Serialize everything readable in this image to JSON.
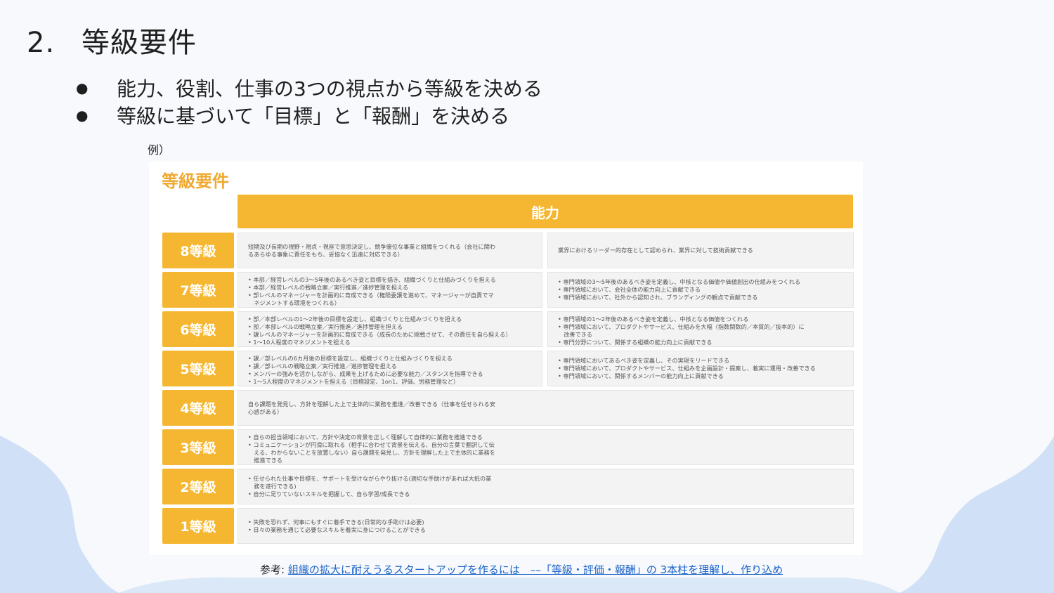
{
  "slide": {
    "number": "2.",
    "title": "等級要件",
    "bullets": [
      "能力、役割、仕事の3つの視点から等級を決める",
      "等級に基づいて「目標」と「報酬」を決める"
    ],
    "bullet_marker": "●",
    "example_label": "例）"
  },
  "table": {
    "title": "等級要件",
    "category_header": "能力",
    "rows": [
      {
        "grade": "8等級",
        "left": [
          "短期及び長期の視野・視点・視座で意思決定し、競争優位な事業と組織をつくれる（会社に関わ",
          "るあらゆる事象に責任をもち、妥協なく迅速に対応できる）"
        ],
        "right": [
          "業界におけるリーダー的存在として認められ、業界に対して技術貢献できる"
        ]
      },
      {
        "grade": "7等級",
        "left": [
          "• 本部／経営レベルの3〜5年後のあるべき姿と目標を描き、組織づくりと仕組みづくりを担える",
          "• 本部／経営レベルの戦略立案／実行推進／進捗管理を担える",
          "• 部レベルのマネージャーを計画的に育成できる（権限委譲を進めて、マネージャーが自責でマ",
          "　ネジメントする環境をつくれる）"
        ],
        "right": [
          "• 専門領域の3〜5年後のあるべき姿を定義し、中核となる価値や価値創出の仕組みをつくれる",
          "• 専門領域において、会社全体の能力向上に貢献できる",
          "• 専門領域において、社外から認知され、ブランディングの観点で貢献できる"
        ]
      },
      {
        "grade": "6等級",
        "left": [
          "• 部／本部レベルの1〜2年後の目標を設定し、組織づくりと仕組みづくりを担える",
          "• 部／本部レベルの戦略立案／実行推進／進捗管理を担える",
          "• 課レベルのマネージャーを計画的に育成できる（成長のために挑戦させて、その責任を自ら担える）",
          "• 1〜10人程度のマネジメントを担える"
        ],
        "right": [
          "• 専門領域の1〜2年後のあるべき姿を定義し、中核となる価値をつくれる",
          "• 専門領域において、プロダクトやサービス、仕組みを大幅（指数関数的／本質的／抜本的）に",
          "　改善できる",
          "• 専門分野について、関係する組織の能力向上に貢献できる"
        ]
      },
      {
        "grade": "5等級",
        "left": [
          "• 課／部レベルの6カ月後の目標を設定し、組織づくりと仕組みづくりを担える",
          "• 課／部レベルの戦略立案／実行推進／進捗管理を担える",
          "• メンバーの強みを活かしながら、成果を上げるために必要な能力／スタンスを指導できる",
          "• 1〜5人程度のマネジメントを担える（目標設定、1on1、評価、労務管理など）"
        ],
        "right": [
          "• 専門領域においてあるべき姿を定義し、その実現をリードできる",
          "• 専門領域において、プロダクトやサービス、仕組みを企画設計・提案し、着実に運用・改善できる",
          "• 専門領域において、関係するメンバーの能力向上に貢献できる"
        ]
      },
      {
        "grade": "4等級",
        "full": [
          "自ら課題を発見し、方針を理解した上で主体的に業務を推進／改善できる（仕事を任せられる安",
          "心感がある）"
        ]
      },
      {
        "grade": "3等級",
        "full": [
          "• 自らの担当領域において、方針や決定の背景を正しく理解して自律的に業務を推進できる",
          "• コミュニケーションが円滑に取れる（相手に合わせて背景を伝える、自分の言葉で翻訳して伝",
          "　える、わからないことを放置しない）自ら課題を発見し、方針を理解した上で主体的に業務を",
          "　推進できる"
        ]
      },
      {
        "grade": "2等級",
        "full": [
          "• 任せられた仕事や目標を、サポートを受けながらやり抜ける(適切な手助けがあれば大抵の業",
          "　務を遂行できる)",
          "• 自分に足りていないスキルを把握して、自ら学習/成長できる"
        ]
      },
      {
        "grade": "1等級",
        "full": [
          "• 失敗を恐れず、何事にもすぐに着手できる(日常的な手助けは必要)",
          "• 日々の業務を通じて必要なスキルを着実に身につけることができる"
        ]
      }
    ]
  },
  "reference": {
    "prefix": "参考: ",
    "link_text": "組織の拡大に耐えうるスタートアップを作るには　––「等級・評価・報酬」の 3本柱を理解し、作り込め"
  },
  "colors": {
    "accent": "#f5b731",
    "title_orange": "#f0a830",
    "link": "#1a62c9",
    "wave": "#cfe0f7"
  }
}
